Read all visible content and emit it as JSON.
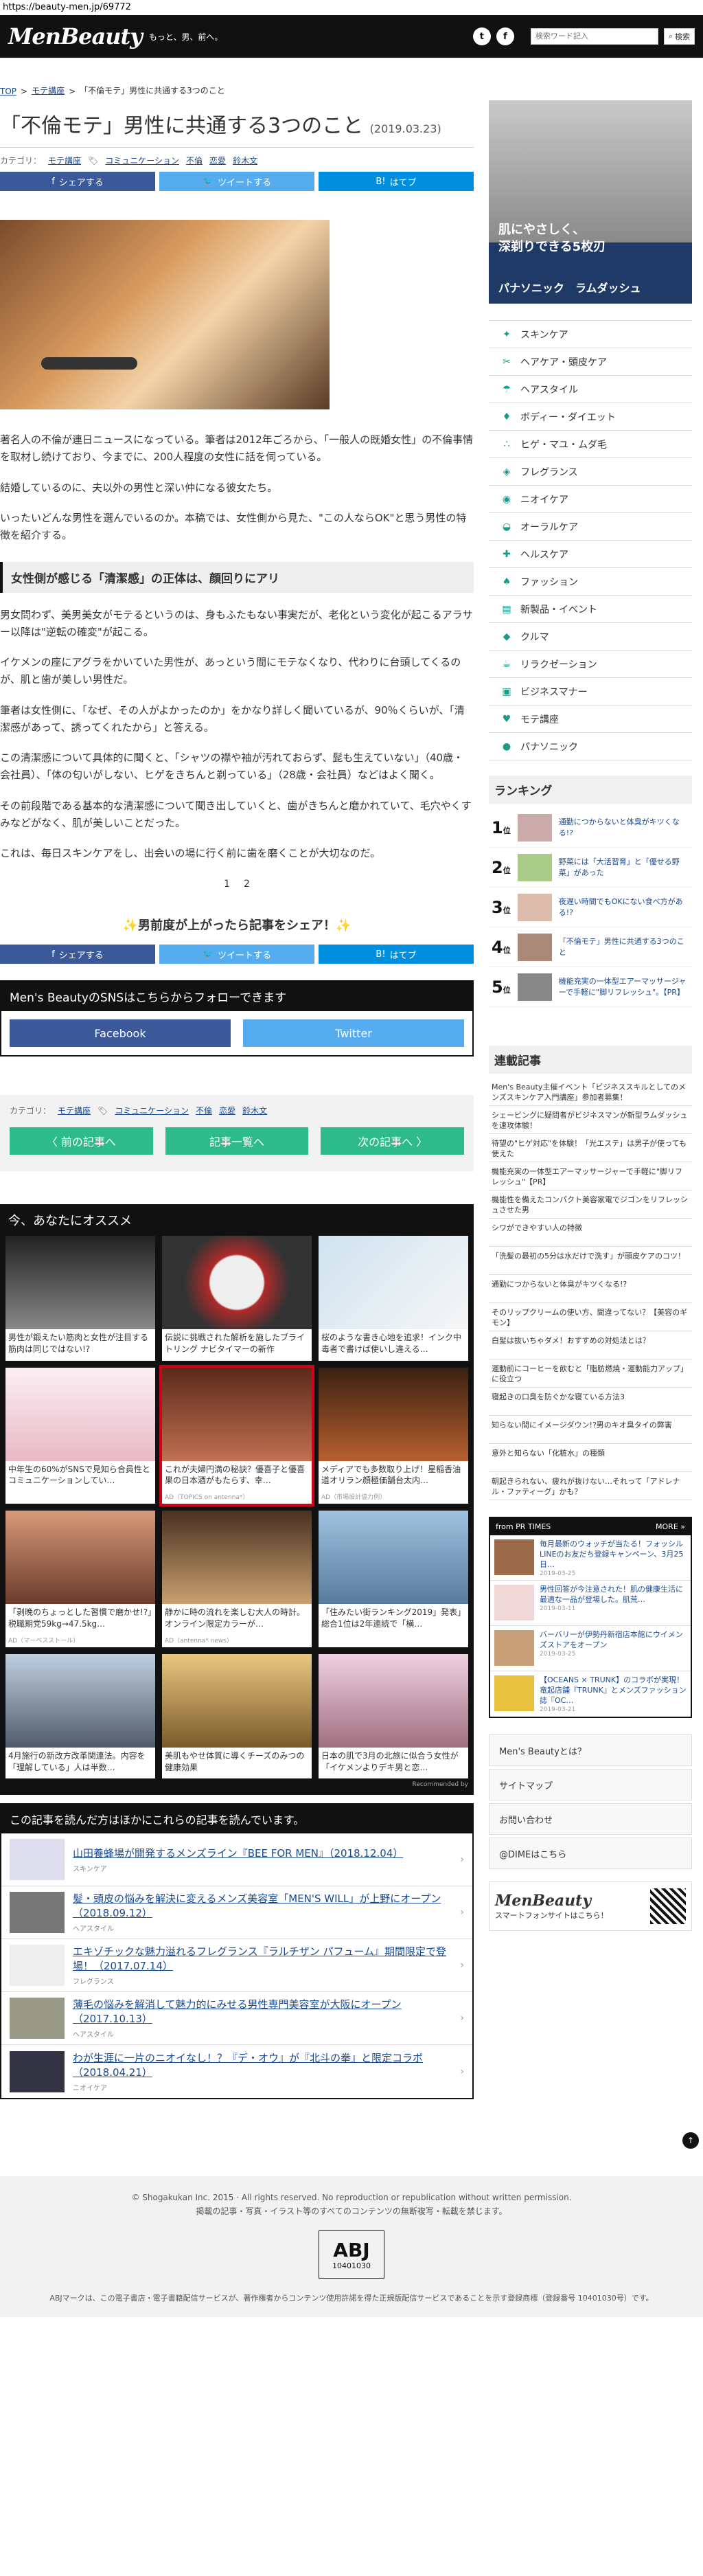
{
  "url": "https://beauty-men.jp/69772",
  "header": {
    "logo": "MenBeauty",
    "tagline": "もっと、男、前へ。",
    "search_placeholder": "検索ワード記入",
    "search_label": "検索"
  },
  "breadcrumb": [
    "TOP",
    "モテ講座",
    "「不倫モテ」男性に共通する3つのこと"
  ],
  "article": {
    "title": "「不倫モテ」男性に共通する3つのこと",
    "date": "(2019.03.23)",
    "category_label": "カテゴリ：",
    "category": "モテ講座",
    "tags": [
      "コミュニケーション",
      "不倫",
      "恋愛",
      "鈴木文"
    ],
    "share": {
      "fb": "シェアする",
      "tw": "ツイートする",
      "hb": "はてブ"
    },
    "paragraphs": [
      "著名人の不倫が連日ニュースになっている。筆者は2012年ごろから、「一般人の既婚女性」の不倫事情を取材し続けており、今までに、200人程度の女性に話を伺っている。",
      "結婚しているのに、夫以外の男性と深い仲になる彼女たち。",
      "いったいどんな男性を選んでいるのか。本稿では、女性側から見た、\"この人ならOK\"と思う男性の特徴を紹介する。"
    ],
    "h2": "女性側が感じる「清潔感」の正体は、顔回りにアリ",
    "paragraphs2": [
      "男女問わず、美男美女がモテるというのは、身もふたもない事実だが、老化という変化が起こるアラサー以降は\"逆転の確変\"が起こる。",
      "イケメンの座にアグラをかいていた男性が、あっという間にモテなくなり、代わりに台頭してくるのが、肌と歯が美しい男性だ。",
      "筆者は女性側に、「なぜ、その人がよかったのか」をかなり詳しく聞いているが、90％くらいが、「清潔感があって、誘ってくれたから」と答える。",
      "この清潔感について具体的に聞くと、「シャツの襟や袖が汚れておらず、髭も生えていない」（40歳・会社員）、「体の匂いがしない、ヒゲをきちんと剃っている」（28歳・会社員）などはよく聞く。",
      "その前段階である基本的な清潔感について聞き出していくと、歯がきちんと磨かれていて、毛穴やくすみなどがなく、肌が美しいことだった。",
      "これは、毎日スキンケアをし、出会いの場に行く前に歯を磨くことが大切なのだ。"
    ],
    "pages": [
      "1",
      "2"
    ],
    "share_cta": "男前度が上がったら記事をシェア！"
  },
  "follow": {
    "heading": "Men's BeautyのSNSはこちらからフォローできます",
    "facebook": "Facebook",
    "twitter": "Twitter"
  },
  "article_nav": {
    "prev": "前の記事へ",
    "list": "記事一覧へ",
    "next": "次の記事へ"
  },
  "reco": {
    "heading": "今、あなたにオススメ",
    "cards": [
      {
        "t": "男性が鍛えたい筋肉と女性が注目する筋肉は同じではない!?",
        "ad": ""
      },
      {
        "t": "伝説に挑戦された解析を施したブライトリング ナビタイマーの新作",
        "ad": ""
      },
      {
        "t": "桜のような書き心地を追求！インク中毒者で書けば使いし違える…",
        "ad": ""
      },
      {
        "t": "中年生の60%がSNSで見知ら合員性とコミュニケーションしてい…",
        "ad": ""
      },
      {
        "t": "これが夫婦円満の秘訣？優喜子と優喜果の日本酒がもたらす、幸…",
        "ad": "AD（TOPICS on antenna*）"
      },
      {
        "t": "メディアでも多数取り上げ！星稲香油道オリラン顔極価舗台太内…",
        "ad": "AD（市場設計協力例）"
      },
      {
        "t": "「剥晩のちょっとした習慣で磨かせ!?」税職期党59kg→47.5kg…",
        "ad": "AD（マーベスストール）"
      },
      {
        "t": "静かに時の流れを楽しむ大人の時計。オンライン限定カラーが…",
        "ad": "AD（antenna* news）"
      },
      {
        "t": "「住みたい街ランキング2019」発表」総合1位は2年連続で「横…",
        "ad": ""
      },
      {
        "t": "4月施行の新改方改革関連法。内容を「理解している」人は半数…",
        "ad": ""
      },
      {
        "t": "美肌もやせ体質に導くチーズのみつの健康効果",
        "ad": ""
      },
      {
        "t": "日本の肌で3月の北旅に似合う女性が「イケメンよりデキ男と恋…",
        "ad": ""
      }
    ],
    "by": "Recommended by"
  },
  "also": {
    "heading": "この記事を読んだ方はほかにこれらの記事を読んでいます。",
    "items": [
      {
        "t": "山田養蜂場が開発するメンズライン『BEE FOR MEN』（2018.12.04）",
        "c": "スキンケア"
      },
      {
        "t": "髪・頭皮の悩みを解決に変えるメンズ美容室「MEN'S WILL」が上野にオープン（2018.09.12）",
        "c": "ヘアスタイル"
      },
      {
        "t": "エキゾチックな魅力溢れるフレグランス『ラルチザン パフューム』期間限定で登場！（2017.07.14）",
        "c": "フレグランス"
      },
      {
        "t": "薄毛の悩みを解消して魅力的にみせる男性専門美容室が大阪にオープン（2017.10.13）",
        "c": "ヘアスタイル"
      },
      {
        "t": "わが生涯に一片のニオイなし！？『デ・オウ』が『北斗の拳』と限定コラボ（2018.04.21）",
        "c": "ニオイケア"
      }
    ]
  },
  "side_ad": {
    "copy": "肌にやさしく、\n深剃りできる5枚刃",
    "brand": "パナソニック　ラムダッシュ"
  },
  "categories": [
    {
      "icon": "✦",
      "label": "スキンケア"
    },
    {
      "icon": "✂",
      "label": "ヘアケア・頭皮ケア"
    },
    {
      "icon": "☂",
      "label": "ヘアスタイル"
    },
    {
      "icon": "♦",
      "label": "ボディー・ダイエット"
    },
    {
      "icon": "∴",
      "label": "ヒゲ・マユ・ムダ毛"
    },
    {
      "icon": "◈",
      "label": "フレグランス"
    },
    {
      "icon": "◉",
      "label": "ニオイケア"
    },
    {
      "icon": "◒",
      "label": "オーラルケア"
    },
    {
      "icon": "✚",
      "label": "ヘルスケア"
    },
    {
      "icon": "♠",
      "label": "ファッション"
    },
    {
      "icon": "▤",
      "label": "新製品・イベント"
    },
    {
      "icon": "◆",
      "label": "クルマ"
    },
    {
      "icon": "☕",
      "label": "リラクゼーション"
    },
    {
      "icon": "▣",
      "label": "ビジネスマナー"
    },
    {
      "icon": "♥",
      "label": "モテ講座"
    },
    {
      "icon": "●",
      "label": "パナソニック"
    }
  ],
  "ranking": {
    "heading": "ランキング",
    "unit": "位",
    "items": [
      {
        "n": "1",
        "t": "通勤につからないと体臭がキツくなる!?"
      },
      {
        "n": "2",
        "t": "野菜には「大活習育」と「優せる野菜」があった"
      },
      {
        "n": "3",
        "t": "夜遅い時間でもOKにない食べ方がある!?"
      },
      {
        "n": "4",
        "t": "「不倫モテ」男性に共通する3つのこと"
      },
      {
        "n": "5",
        "t": "機能充実の一体型エアーマッサージャーで手軽に\"脚リフレッシュ\"。【PR】"
      }
    ]
  },
  "serial": {
    "heading": "連載記事",
    "items": [
      "Men's Beauty主催イベント「ビジネススキルとしてのメンズスキンケア入門講座」参加者募集！",
      "シェービングに疑問者がビジネスマンが新型ラムダッシュを速攻体験！",
      "待望の\"ヒゲ対応\"を体験！「光エステ」は男子が使っても使えた",
      "機能充実の一体型エアーマッサージャーで手軽に\"脚リフレッシュ\"【PR】",
      "機能性を備えたコンパクト美容家電でジゴンをリフレッシュさせた男",
      "シワができやすい人の特徴",
      "「洗髪の最初の5分は水だけで洗す」が頭皮ケアのコツ！",
      "通勤につからないと体臭がキツくなる!?",
      "そのリップクリームの使い方、間違ってない？【美容のギモン】",
      "白髪は抜いちゃダメ！おすすめの対処法とは？",
      "運動前にコーヒーを飲むと「脂肪燃焼・運動能力アップ」に役立つ",
      "寝起きの口臭を防ぐかな寝ている方法3",
      "知らない間にイメージダウン!?男のキオ臭タイの弊害",
      "意外と知らない「化粧水」の種類",
      "朝起きられない、疲れが抜けない…それって「アドレナル・ファティーグ」かも？"
    ]
  },
  "ptimes": {
    "heading": "from PR TIMES",
    "more": "MORE »",
    "items": [
      {
        "t": "毎月最新のウォッチが当たる！フォッシルLINEのお友だち登録キャンペーン、3月25日…",
        "d": "2019-03-25"
      },
      {
        "t": "男性回答が今注意された！肌の健康生活に最適な一品が登場した。肌荒…",
        "d": "2019-03-11"
      },
      {
        "t": "バーバリーが伊勢丹新宿店本館にウイメンズストアをオープン",
        "d": "2019-03-25"
      },
      {
        "t": "【OCEANS × TRUNK】のコラボが実現！竜起店舗『TRUNK』とメンズファッション誌『OC…",
        "d": "2019-03-21"
      }
    ]
  },
  "sidelinks": [
    "Men's Beautyとは？",
    "サイトマップ",
    "お問い合わせ",
    "@DIMEはこちら"
  ],
  "app": {
    "logo": "MenBeauty",
    "sub": "スマートフォンサイトはこちら！"
  },
  "footer": {
    "copyright": "© Shogakukan Inc. 2015 · All rights reserved. No reproduction or republication without written permission.",
    "note": "掲載の記事・写真・イラスト等のすべてのコンテンツの無断複写・転載を禁じます。",
    "abj_mark": "ABJ",
    "abj_num": "10401030",
    "abj_note": "ABJマークは、この電子書店・電子書籍配信サービスが、著作権者からコンテンツ使用許諾を得た正規版配信サービスであることを示す登録商標（登録番号 10401030号）です。"
  }
}
